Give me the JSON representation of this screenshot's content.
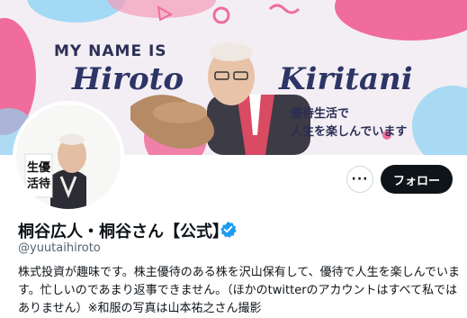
{
  "banner": {
    "line1": "MY NAME IS",
    "name_first": "Hiroto",
    "name_last": "Kiritani",
    "tagline_line1": "優待生活で",
    "tagline_line2": "人生を楽しんでいます",
    "accent_colors": [
      "#f06c9b",
      "#8fd3f4",
      "#2d3566"
    ]
  },
  "avatar": {
    "sign_text": "生活優待"
  },
  "actions": {
    "more_label": "···",
    "follow_label": "フォロー"
  },
  "profile": {
    "display_name": "桐谷広人・桐谷さん【公式】",
    "handle": "@yuutaihiroto",
    "bio": "株式投資が趣味です。株主優待のある株を沢山保有して、優待で人生を楽しんでいます。忙しいのであまり返事できません。（ほかのtwitterのアカウントはすべて私ではありません）※和服の写真は山本祐之さん撮影"
  },
  "icons": {
    "verified": "verified-badge-icon",
    "more": "more-icon"
  }
}
